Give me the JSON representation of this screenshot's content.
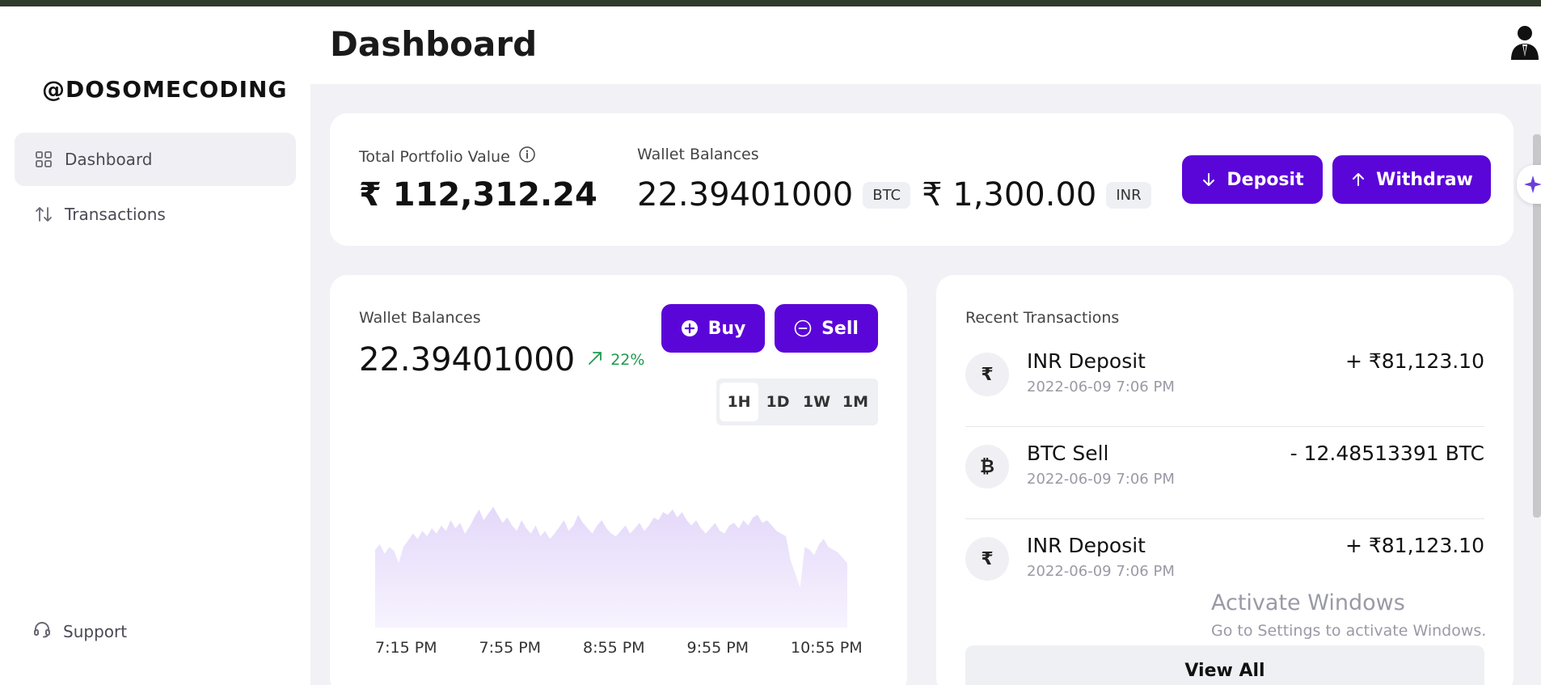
{
  "brand": "@DOSOMECODING",
  "sidebar": {
    "items": [
      {
        "label": "Dashboard",
        "icon": "grid-icon",
        "active": true
      },
      {
        "label": "Transactions",
        "icon": "swap-vertical-icon",
        "active": false
      }
    ],
    "support_label": "Support"
  },
  "header": {
    "title": "Dashboard",
    "user_icon": "user-icon"
  },
  "portfolio": {
    "label": "Total Portfolio Value",
    "value": "₹ 112,312.24",
    "wallet_label": "Wallet Balances",
    "btc_amount": "22.39401000",
    "btc_unit": "BTC",
    "inr_amount": "₹ 1,300.00",
    "inr_unit": "INR",
    "deposit_label": "Deposit",
    "withdraw_label": "Withdraw"
  },
  "wallet_card": {
    "label": "Wallet Balances",
    "value": "22.39401000",
    "change": "22%",
    "buy_label": "Buy",
    "sell_label": "Sell",
    "ranges": [
      "1H",
      "1D",
      "1W",
      "1M"
    ],
    "active_range": "1H"
  },
  "chart_data": {
    "type": "area",
    "title": "",
    "xlabel": "",
    "ylabel": "",
    "x_ticks": [
      "7:15 PM",
      "7:55 PM",
      "8:55 PM",
      "9:55 PM",
      "10:55 PM"
    ],
    "values": [
      58,
      62,
      55,
      60,
      57,
      48,
      60,
      65,
      70,
      66,
      72,
      68,
      74,
      70,
      76,
      72,
      80,
      74,
      78,
      70,
      75,
      82,
      88,
      80,
      85,
      90,
      84,
      78,
      82,
      76,
      72,
      80,
      74,
      70,
      76,
      68,
      72,
      66,
      70,
      75,
      80,
      72,
      76,
      84,
      78,
      74,
      70,
      76,
      80,
      74,
      70,
      68,
      72,
      76,
      70,
      74,
      78,
      72,
      76,
      82,
      80,
      86,
      84,
      88,
      82,
      86,
      80,
      76,
      80,
      74,
      70,
      74,
      78,
      72,
      70,
      76,
      78,
      74,
      80,
      76,
      82,
      84,
      78,
      80,
      76,
      72,
      70,
      68,
      50,
      40,
      30,
      60,
      58,
      54,
      62,
      66,
      60,
      58,
      56,
      52,
      48
    ],
    "ylim": [
      0,
      100
    ],
    "color": "#ede6fb"
  },
  "transactions": {
    "title": "Recent Transactions",
    "items": [
      {
        "icon": "₹",
        "icon_name": "rupee-icon",
        "name": "INR Deposit",
        "date": "2022-06-09 7:06 PM",
        "amount": "+ ₹81,123.10"
      },
      {
        "icon": "₿",
        "icon_name": "bitcoin-icon",
        "name": "BTC Sell",
        "date": "2022-06-09 7:06 PM",
        "amount": "- 12.48513391 BTC"
      },
      {
        "icon": "₹",
        "icon_name": "rupee-icon",
        "name": "INR Deposit",
        "date": "2022-06-09 7:06 PM",
        "amount": "+ ₹81,123.10"
      }
    ],
    "view_all_label": "View All"
  },
  "watermark": {
    "line1": "Activate Windows",
    "line2": "Go to Settings to activate Windows."
  },
  "colors": {
    "accent": "#5b06d8",
    "positive": "#1f9a4f",
    "page_bg": "#f1f1f6"
  }
}
